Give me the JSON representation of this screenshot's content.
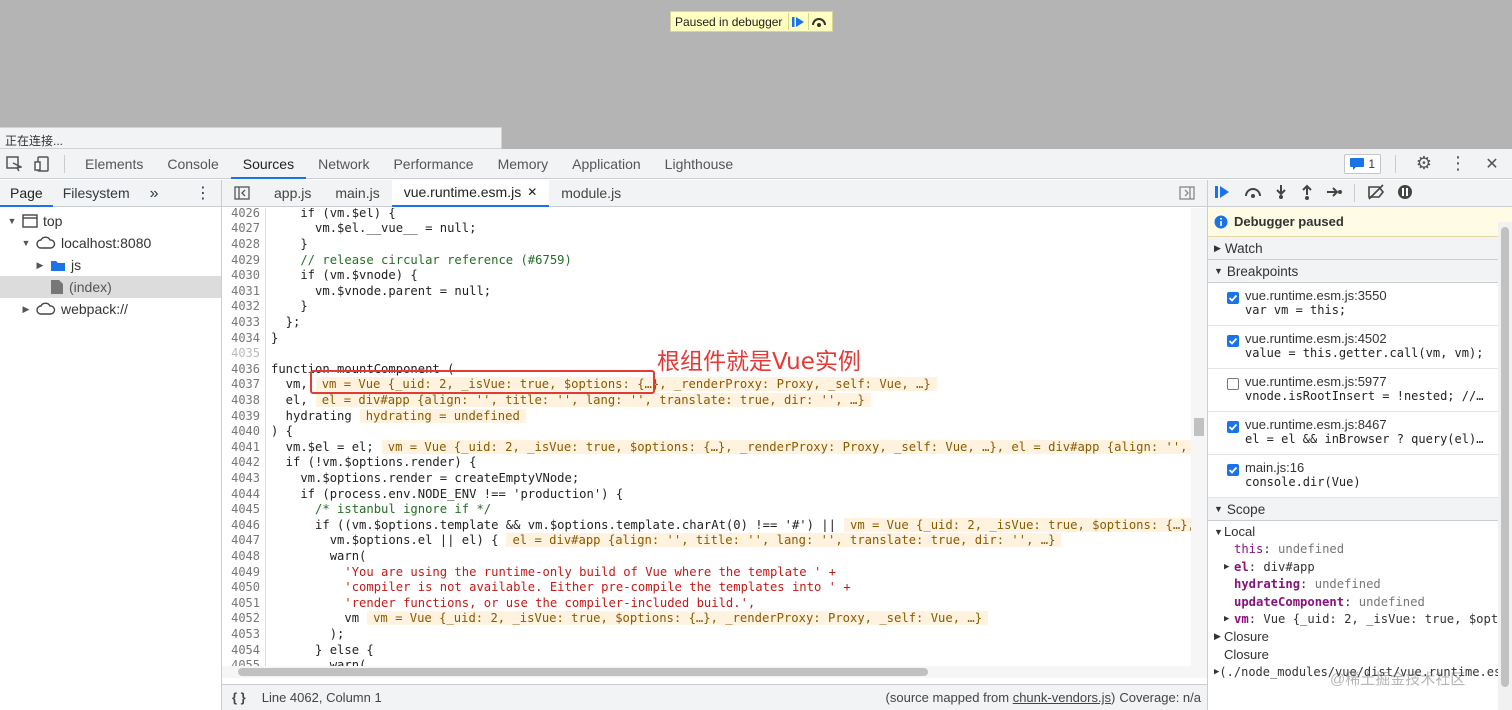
{
  "banner": {
    "text": "Paused in debugger"
  },
  "status": {
    "text": "正在连接..."
  },
  "toolbar": {
    "tabs": [
      "Elements",
      "Console",
      "Sources",
      "Network",
      "Performance",
      "Memory",
      "Application",
      "Lighthouse"
    ],
    "issues_count": "1"
  },
  "navigator": {
    "tabs": [
      "Page",
      "Filesystem"
    ],
    "tree": [
      {
        "label": "top",
        "indent": 0,
        "tw": "▼",
        "icon": "frame"
      },
      {
        "label": "localhost:8080",
        "indent": 1,
        "tw": "▼",
        "icon": "cloud"
      },
      {
        "label": "js",
        "indent": 2,
        "tw": "▶",
        "icon": "folder"
      },
      {
        "label": "(index)",
        "indent": 2,
        "tw": "",
        "icon": "file",
        "selected": true
      },
      {
        "label": "webpack://",
        "indent": 1,
        "tw": "▶",
        "icon": "cloud"
      }
    ]
  },
  "editor": {
    "tabs": [
      "app.js",
      "main.js",
      "vue.runtime.esm.js",
      "module.js"
    ],
    "active_tab": "vue.runtime.esm.js",
    "lines": [
      {
        "n": "4026",
        "t": "    if (vm.$el) {"
      },
      {
        "n": "4027",
        "t": "      vm.$el.__vue__ = null;"
      },
      {
        "n": "4028",
        "t": "    }"
      },
      {
        "n": "4029",
        "t": "    // release circular reference (#6759)",
        "cls": "cm"
      },
      {
        "n": "4030",
        "t": "    if (vm.$vnode) {"
      },
      {
        "n": "4031",
        "t": "      vm.$vnode.parent = null;"
      },
      {
        "n": "4032",
        "t": "    }"
      },
      {
        "n": "4033",
        "t": "  };"
      },
      {
        "n": "4034",
        "t": "}"
      },
      {
        "n": "4035",
        "t": ""
      },
      {
        "n": "4036",
        "t": "function mountComponent ("
      },
      {
        "n": "4037",
        "t": "  vm,",
        "inl": "vm = Vue {_uid: 2, _isVue: true, $options: {…}, _renderProxy: Proxy, _self: Vue, …}"
      },
      {
        "n": "4038",
        "t": "  el,",
        "inl": "el = div#app {align: '', title: '', lang: '', translate: true, dir: '', …}"
      },
      {
        "n": "4039",
        "t": "  hydrating",
        "inl": "hydrating = undefined"
      },
      {
        "n": "4040",
        "t": ") {"
      },
      {
        "n": "4041",
        "t": "  vm.$el = el;",
        "inl": "vm = Vue {_uid: 2, _isVue: true, $options: {…}, _renderProxy: Proxy, _self: Vue, …}, el = div#app {align: '', title: '', lang: ''"
      },
      {
        "n": "4042",
        "t": "  if (!vm.$options.render) {"
      },
      {
        "n": "4043",
        "t": "    vm.$options.render = createEmptyVNode;"
      },
      {
        "n": "4044",
        "t": "    if (process.env.NODE_ENV !== 'production') {"
      },
      {
        "n": "4045",
        "t": "      /* istanbul ignore if */",
        "cls": "cm"
      },
      {
        "n": "4046",
        "t": "      if ((vm.$options.template && vm.$options.template.charAt(0) !== '#') ||",
        "inl": "vm = Vue {_uid: 2, _isVue: true, $options: {…}, _renderProxy"
      },
      {
        "n": "4047",
        "t": "        vm.$options.el || el) {",
        "inl": "el = div#app {align: '', title: '', lang: '', translate: true, dir: '', …}"
      },
      {
        "n": "4048",
        "t": "        warn("
      },
      {
        "n": "4049",
        "t": "          'You are using the runtime-only build of Vue where the template ' +",
        "cls": "st"
      },
      {
        "n": "4050",
        "t": "          'compiler is not available. Either pre-compile the templates into ' +",
        "cls": "st"
      },
      {
        "n": "4051",
        "t": "          'render functions, or use the compiler-included build.',",
        "cls": "st"
      },
      {
        "n": "4052",
        "t": "          vm",
        "inl": "vm = Vue {_uid: 2, _isVue: true, $options: {…}, _renderProxy: Proxy, _self: Vue, …}"
      },
      {
        "n": "4053",
        "t": "        );"
      },
      {
        "n": "4054",
        "t": "      } else {"
      },
      {
        "n": "4055",
        "t": "        warn("
      }
    ],
    "annotation": "根组件就是Vue实例",
    "status_position": "Line 4062, Column 1",
    "source_mapped_prefix": "(source mapped from ",
    "source_mapped_file": "chunk-vendors.js",
    "source_mapped_suffix": ")",
    "coverage": "Coverage: n/a"
  },
  "sidebar": {
    "paused": "Debugger paused",
    "watch": "Watch",
    "breakpoints_title": "Breakpoints",
    "breakpoints": [
      {
        "file": "vue.runtime.esm.js:3550",
        "code": "var vm = this;",
        "checked": true
      },
      {
        "file": "vue.runtime.esm.js:4502",
        "code": "value = this.getter.call(vm, vm);",
        "checked": true
      },
      {
        "file": "vue.runtime.esm.js:5977",
        "code": "vnode.isRootInsert = !nested; //…",
        "checked": false
      },
      {
        "file": "vue.runtime.esm.js:8467",
        "code": "el = el && inBrowser ? query(el)…",
        "checked": true
      },
      {
        "file": "main.js:16",
        "code": "console.dir(Vue)",
        "checked": true
      }
    ],
    "scope_title": "Scope",
    "local": "Local",
    "scope": [
      {
        "arrow": "",
        "key": "this",
        "sep": ": ",
        "val": "undefined",
        "bold": false
      },
      {
        "arrow": "▶",
        "key": "el",
        "sep": ": ",
        "val": "div#app",
        "bold": true
      },
      {
        "arrow": "",
        "key": "hydrating",
        "sep": ": ",
        "val": "undefined",
        "bold": true
      },
      {
        "arrow": "",
        "key": "updateComponent",
        "sep": ": ",
        "val": "undefined",
        "bold": true
      },
      {
        "arrow": "▶",
        "key": "vm",
        "sep": ": ",
        "val": "Vue {_uid: 2, _isVue: true, $opti",
        "bold": true
      }
    ],
    "closure": "Closure",
    "closure2": "Closure",
    "closure_path": "(./node_modules/vue/dist/vue.runtime.esm.js)"
  },
  "watermark": "@稀土掘金技术社区",
  "colors": {
    "accent": "#1a73e8",
    "annotation": "#e53935"
  }
}
